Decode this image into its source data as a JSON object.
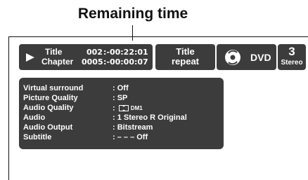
{
  "callout": {
    "label": "Remaining time"
  },
  "title_panel": {
    "title_label": "Title",
    "title_number": "002",
    "title_time": ":-00:22:01",
    "chapter_label": "Chapter",
    "chapter_number": "0005",
    "chapter_time": ":-00:00:07"
  },
  "repeat_panel": {
    "line1": "Title",
    "line2": "repeat"
  },
  "disc_panel": {
    "disc_type": "DVD",
    "icon": "disc-icon"
  },
  "audio_panel": {
    "channel_number": "3",
    "mode": "Stereo"
  },
  "info_panel": {
    "rows": [
      {
        "key": "Virtual surround",
        "value": ": Off"
      },
      {
        "key": "Picture Quality",
        "value": ": SP"
      },
      {
        "key": "Audio Quality",
        "value": ":",
        "icon": "dolby-digital-icon",
        "suffix": "DM1"
      },
      {
        "key": "Audio",
        "value": ": 1 Stereo R Original"
      },
      {
        "key": "Audio Output",
        "value": ": Bitstream"
      },
      {
        "key": "Subtitle",
        "value": ": – – – Off"
      }
    ]
  }
}
